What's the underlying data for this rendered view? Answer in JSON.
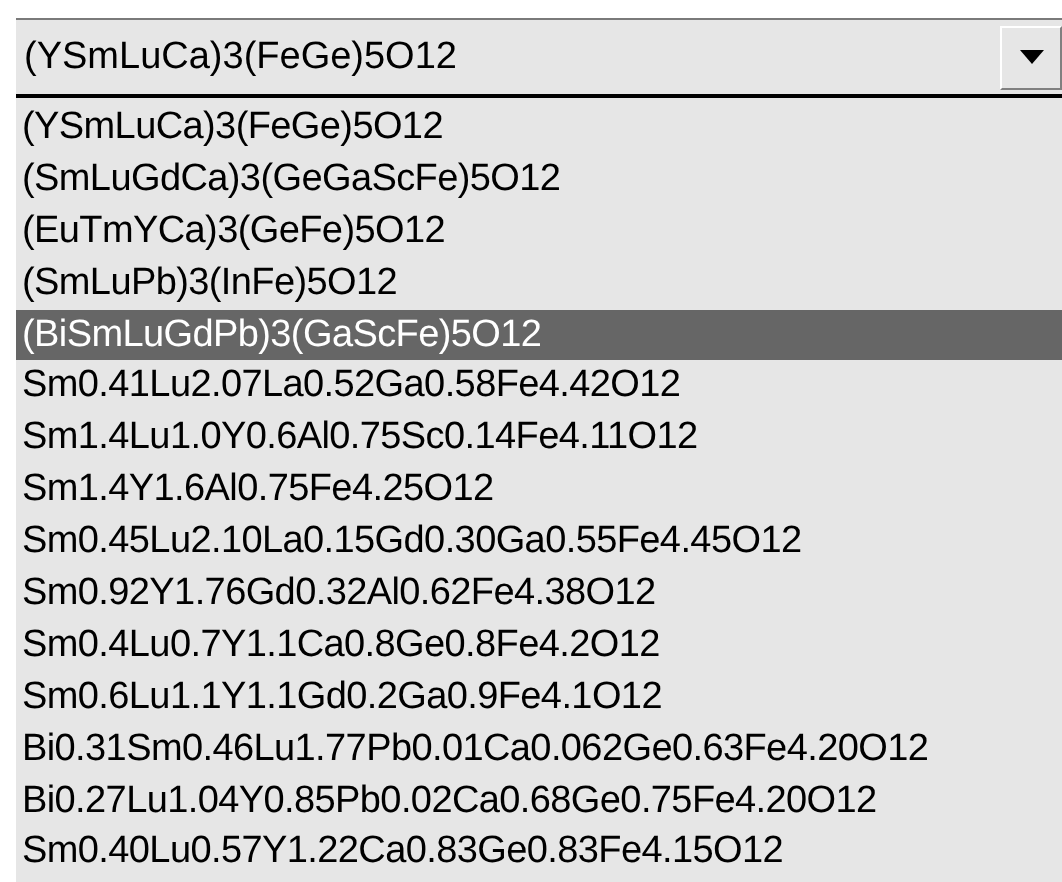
{
  "combo": {
    "value": "(YSmLuCa)3(FeGe)5O12"
  },
  "options": [
    {
      "label": "(YSmLuCa)3(FeGe)5O12",
      "selected": false
    },
    {
      "label": "(SmLuGdCa)3(GeGaScFe)5O12",
      "selected": false
    },
    {
      "label": "(EuTmYCa)3(GeFe)5O12",
      "selected": false
    },
    {
      "label": "(SmLuPb)3(InFe)5O12",
      "selected": false
    },
    {
      "label": "(BiSmLuGdPb)3(GaScFe)5O12",
      "selected": true
    },
    {
      "label": "Sm0.41Lu2.07La0.52Ga0.58Fe4.42O12",
      "selected": false
    },
    {
      "label": "Sm1.4Lu1.0Y0.6Al0.75Sc0.14Fe4.11O12",
      "selected": false
    },
    {
      "label": "Sm1.4Y1.6Al0.75Fe4.25O12",
      "selected": false
    },
    {
      "label": "Sm0.45Lu2.10La0.15Gd0.30Ga0.55Fe4.45O12",
      "selected": false
    },
    {
      "label": "Sm0.92Y1.76Gd0.32Al0.62Fe4.38O12",
      "selected": false
    },
    {
      "label": "Sm0.4Lu0.7Y1.1Ca0.8Ge0.8Fe4.2O12",
      "selected": false
    },
    {
      "label": "Sm0.6Lu1.1Y1.1Gd0.2Ga0.9Fe4.1O12",
      "selected": false
    },
    {
      "label": "Bi0.31Sm0.46Lu1.77Pb0.01Ca0.062Ge0.63Fe4.20O12",
      "selected": false
    },
    {
      "label": "Bi0.27Lu1.04Y0.85Pb0.02Ca0.68Ge0.75Fe4.20O12",
      "selected": false
    },
    {
      "label": "Sm0.40Lu0.57Y1.22Ca0.83Ge0.83Fe4.15O12",
      "selected": false
    }
  ]
}
